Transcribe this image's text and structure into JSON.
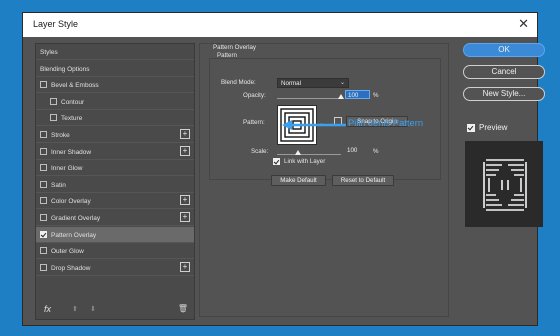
{
  "dialog": {
    "title": "Layer Style",
    "close_glyph": "✕"
  },
  "sidebar": {
    "items": [
      {
        "label": "Styles",
        "checkbox": false,
        "checked": false,
        "indent": false,
        "plus": false
      },
      {
        "label": "Blending Options",
        "checkbox": false,
        "checked": false,
        "indent": false,
        "plus": false
      },
      {
        "label": "Bevel & Emboss",
        "checkbox": true,
        "checked": false,
        "indent": false,
        "plus": false
      },
      {
        "label": "Contour",
        "checkbox": true,
        "checked": false,
        "indent": true,
        "plus": false
      },
      {
        "label": "Texture",
        "checkbox": true,
        "checked": false,
        "indent": true,
        "plus": false
      },
      {
        "label": "Stroke",
        "checkbox": true,
        "checked": false,
        "indent": false,
        "plus": true
      },
      {
        "label": "Inner Shadow",
        "checkbox": true,
        "checked": false,
        "indent": false,
        "plus": true
      },
      {
        "label": "Inner Glow",
        "checkbox": true,
        "checked": false,
        "indent": false,
        "plus": false
      },
      {
        "label": "Satin",
        "checkbox": true,
        "checked": false,
        "indent": false,
        "plus": false
      },
      {
        "label": "Color Overlay",
        "checkbox": true,
        "checked": false,
        "indent": false,
        "plus": true
      },
      {
        "label": "Gradient Overlay",
        "checkbox": true,
        "checked": false,
        "indent": false,
        "plus": true
      },
      {
        "label": "Pattern Overlay",
        "checkbox": true,
        "checked": true,
        "indent": false,
        "plus": false,
        "selected": true
      },
      {
        "label": "Outer Glow",
        "checkbox": true,
        "checked": false,
        "indent": false,
        "plus": false
      },
      {
        "label": "Drop Shadow",
        "checkbox": true,
        "checked": false,
        "indent": false,
        "plus": true
      }
    ],
    "footer": {
      "fx_label": "fx",
      "up_glyph": "⬆",
      "down_glyph": "⬇",
      "trash_glyph": "🗑"
    }
  },
  "pattern_overlay": {
    "group_title": "Pattern Overlay",
    "sub_title": "Pattern",
    "blend_mode_label": "Blend Mode:",
    "blend_mode_value": "Normal",
    "opacity_label": "Opacity:",
    "opacity_value": "100",
    "opacity_fraction": 1.0,
    "percent_unit": "%",
    "pattern_label": "Pattern:",
    "snap_button": "Snap to Origin",
    "scale_label": "Scale:",
    "scale_value": "100",
    "scale_fraction": 0.33,
    "link_label": "Link with Layer",
    "link_checked": true,
    "make_default_button": "Make Default",
    "reset_default_button": "Reset to Default"
  },
  "annotation": {
    "text": "Pilih Jenis Pattern",
    "color": "#3aa0f0"
  },
  "actions": {
    "ok": "OK",
    "cancel": "Cancel",
    "new_style": "New Style...",
    "preview_label": "Preview",
    "preview_checked": true
  },
  "colors": {
    "accent": "#3a8ad8",
    "background": "#1e7fc4",
    "panel": "#535353"
  }
}
